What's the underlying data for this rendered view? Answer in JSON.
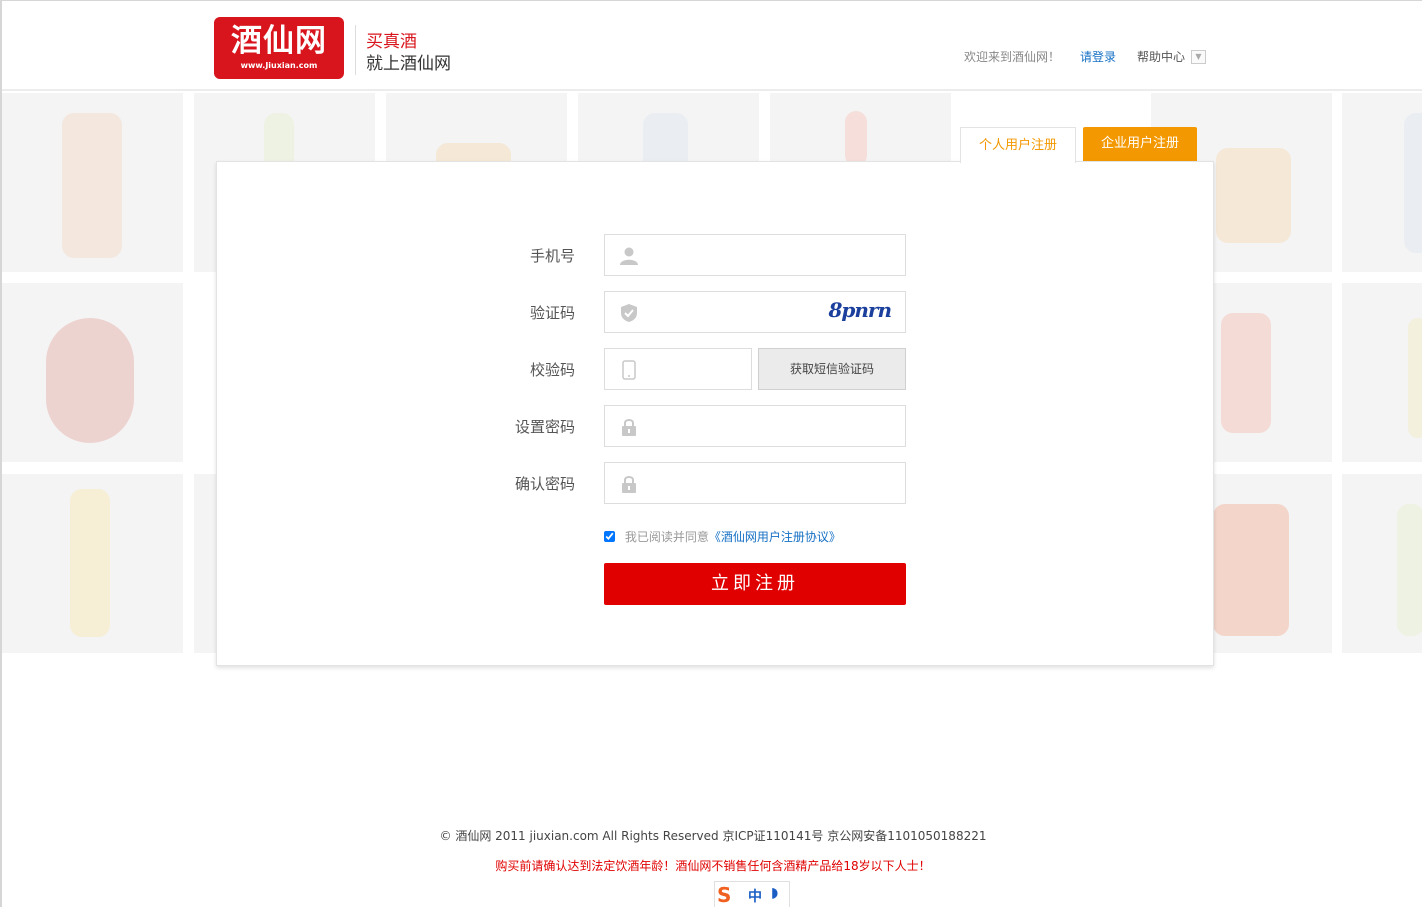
{
  "header": {
    "logo_text": "酒仙网",
    "logo_url": "www.Jiuxian.com",
    "slogan_line1": "买真酒",
    "slogan_line2": "就上酒仙网",
    "welcome": "欢迎来到酒仙网！",
    "login": "请登录",
    "help": "帮助中心"
  },
  "tabs": {
    "personal": "个人用户注册",
    "company": "企业用户注册"
  },
  "form": {
    "phone_label": "手机号",
    "verify_label": "验证码",
    "captcha_text": "8pnrn",
    "check_label": "校验码",
    "sms_button": "获取短信验证码",
    "password_label": "设置密码",
    "confirm_label": "确认密码",
    "agree_text": "我已阅读并同意",
    "agree_link": "《酒仙网用户注册协议》",
    "agree_checked": true,
    "submit": "立即注册"
  },
  "footer": {
    "copyright": "©  酒仙网  2011 jiuxian.com All  Rights Reserved  京ICP证110141号  京公网安备1101050188221",
    "warning": "购买前请确认达到法定饮酒年龄！酒仙网不销售任何含酒精产品给18岁以下人士！"
  },
  "ime": {
    "logo": "S",
    "mode": "中",
    "moon": "◗"
  },
  "colors": {
    "brand_red": "#d8141c",
    "tab_orange": "#f39800",
    "submit_red": "#e00000",
    "link_blue": "#1570c4"
  }
}
